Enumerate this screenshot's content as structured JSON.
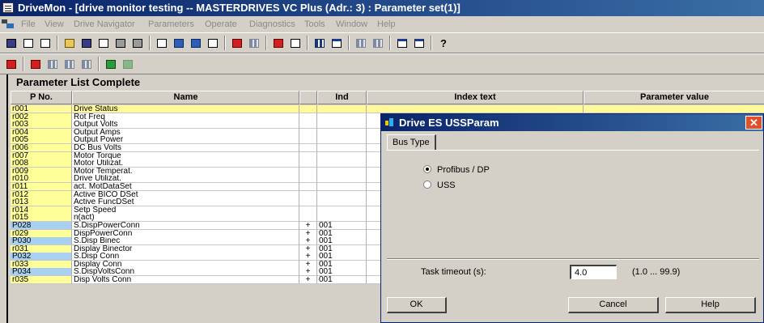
{
  "window": {
    "title": "DriveMon - [drive monitor testing -- MASTERDRIVES VC Plus  (Adr.: 3) : Parameter set(1)]"
  },
  "menu": [
    "File",
    "View",
    "Drive Navigator",
    "Parameters",
    "Operate",
    "Diagnostics",
    "Tools",
    "Window",
    "Help"
  ],
  "list": {
    "title": "Parameter List Complete",
    "headers": {
      "pno": "P No.",
      "name": "Name",
      "ind": "Ind",
      "index_text": "Index text",
      "value": "Parameter value"
    },
    "rows": [
      {
        "pno": "r001",
        "name": "Drive Status",
        "plus": "",
        "ind": ""
      },
      {
        "pno": "r002",
        "name": "Rot Freq",
        "plus": "",
        "ind": ""
      },
      {
        "pno": "r003",
        "name": "Output Volts",
        "plus": "",
        "ind": ""
      },
      {
        "pno": "r004",
        "name": "Output Amps",
        "plus": "",
        "ind": ""
      },
      {
        "pno": "r005",
        "name": "Output Power",
        "plus": "",
        "ind": ""
      },
      {
        "pno": "r006",
        "name": "DC Bus Volts",
        "plus": "",
        "ind": ""
      },
      {
        "pno": "r007",
        "name": "Motor Torque",
        "plus": "",
        "ind": ""
      },
      {
        "pno": "r008",
        "name": "Motor Utilizat.",
        "plus": "",
        "ind": ""
      },
      {
        "pno": "r009",
        "name": "Motor Temperat.",
        "plus": "",
        "ind": ""
      },
      {
        "pno": "r010",
        "name": "Drive Utilizat.",
        "plus": "",
        "ind": ""
      },
      {
        "pno": "r011",
        "name": "act. MotDataSet",
        "plus": "",
        "ind": ""
      },
      {
        "pno": "r012",
        "name": "Active BICO DSet",
        "plus": "",
        "ind": ""
      },
      {
        "pno": "r013",
        "name": "Active FuncDSet",
        "plus": "",
        "ind": ""
      },
      {
        "pno": "r014",
        "name": "Setp Speed",
        "plus": "",
        "ind": ""
      },
      {
        "pno": "r015",
        "name": "n(act)",
        "plus": "",
        "ind": ""
      },
      {
        "pno": "P028",
        "name": "S.DispPowerConn",
        "plus": "+",
        "ind": "001"
      },
      {
        "pno": "r029",
        "name": "DispPowerConn",
        "plus": "+",
        "ind": "001"
      },
      {
        "pno": "P030",
        "name": "S.Disp Binec",
        "plus": "+",
        "ind": "001"
      },
      {
        "pno": "r031",
        "name": "Display Binector",
        "plus": "+",
        "ind": "001"
      },
      {
        "pno": "P032",
        "name": "S.Disp Conn",
        "plus": "+",
        "ind": "001"
      },
      {
        "pno": "r033",
        "name": "Display Conn",
        "plus": "+",
        "ind": "001"
      },
      {
        "pno": "P034",
        "name": "S.DispVoltsConn",
        "plus": "+",
        "ind": "001"
      },
      {
        "pno": "r035",
        "name": "Disp Volts Conn",
        "plus": "+",
        "ind": "001"
      }
    ]
  },
  "dialog": {
    "title": "Drive ES USSParam",
    "close": "✕",
    "tab": "Bus Type",
    "options": [
      {
        "label": "Profibus / DP",
        "selected": true
      },
      {
        "label": "USS",
        "selected": false
      }
    ],
    "timeout_label": "Task timeout (s):",
    "timeout_value": "4.0",
    "timeout_range": "(1.0 ... 99.9)",
    "ok": "OK",
    "cancel": "Cancel",
    "help": "Help"
  },
  "colors": {
    "title_bar": "#0a246a",
    "row_selected": "#fff99a",
    "read_only_param": "#ffff9a",
    "writable_param": "#a8d0f2"
  }
}
